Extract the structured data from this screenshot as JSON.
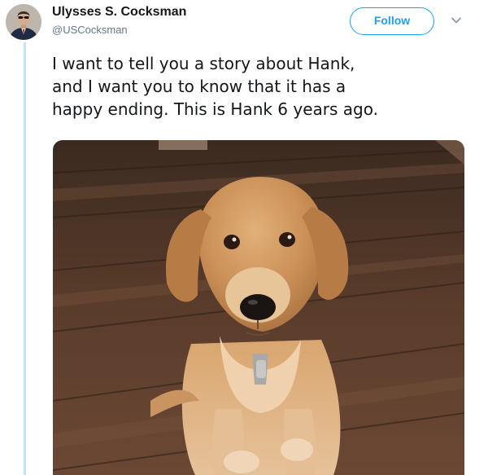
{
  "author": {
    "display_name": "Ulysses S. Cocksman",
    "handle": "@USCocksman"
  },
  "actions": {
    "follow_label": "Follow"
  },
  "tweet": {
    "text_lines": [
      "I want to tell you a story about Hank,",
      "and I want you to know that it has a",
      "happy ending. This is Hank 6 years ago."
    ]
  },
  "icons": {
    "menu": "chevron-down-icon",
    "avatar": "avatar-portrait"
  },
  "colors": {
    "accent": "#1da1f2",
    "handle": "#657786",
    "text": "#14171a",
    "thread_line": "#bfe3f8"
  }
}
